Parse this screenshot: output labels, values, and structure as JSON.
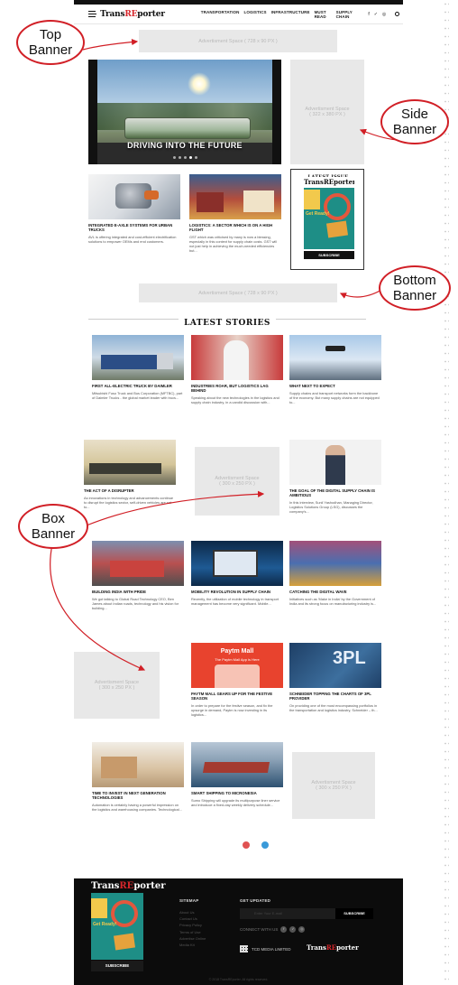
{
  "header": {
    "logo_pre": "Trans",
    "logo_re": "RE",
    "logo_post": "porter",
    "nav": [
      "TRANSPORTATION",
      "LOGISTICS",
      "INFRASTRUCTURE",
      "MUST READ",
      "SUPPLY CHAIN"
    ],
    "social": [
      "f",
      "✓",
      "◎"
    ]
  },
  "ads": {
    "top_line1": "Advertisment Space",
    "top_line2": "( 728 x 90 PX )",
    "side_line1": "Advertisment Space",
    "side_line2": "( 322 x 380 PX )",
    "bottom_line1": "Advertisment Space",
    "bottom_line2": "( 728 x 90 PX )",
    "box_line1": "Advertisment Space",
    "box_line2": "( 300 x 250 PX )"
  },
  "hero": {
    "title": "DRIVING INTO THE FUTURE",
    "slides": 5,
    "active_slide": 4
  },
  "featured": [
    {
      "title": "INTEGRATED E-AXLE SYSTEMS FOR URBAN TRUCKS",
      "excerpt": "AVL is offering integrated and cost-efficient electrification solutions to empower OEMs and end customers."
    },
    {
      "title": "LOGISTICS: A SECTOR WHICH IS ON A HIGH FLIGHT",
      "excerpt": "GST which was criticised by many is now a blessing, especially in this context for supply chain costs. GST will not just help in achieving the much-needed efficiencies but..."
    }
  ],
  "issue": {
    "heading": "LATEST ISSUE",
    "mag_title": "TransREporter",
    "mag_ready": "Get Ready!",
    "subscribe": "SUBSCRIBE"
  },
  "latest_heading": "LATEST STORIES",
  "stories": [
    {
      "title": "FIRST ALL-ELECTRIC TRUCK BY DAIMLER",
      "excerpt": "Mitsubishi Fuso Truck and Bus Corporation (MFTBC), part of Daimler Trucks - the global market leader with trucs..."
    },
    {
      "title": "INDUSTRIES ROAR, BUT LOGISTICS LAG BEHIND",
      "excerpt": "Speaking about the new technologies in the logistics and supply chain industry, in a candid discussion with..."
    },
    {
      "title": "WHAT NEXT TO EXPECT",
      "excerpt": "Supply chains and transport networks form the backbone of the economy. But many supply chains are not equipped to..."
    },
    {
      "title": "THE ACT OF A DISRUPTER",
      "excerpt": "As innovations in technology and advancements continue to disrupt the logistics sector, self-driven vehicles are set to..."
    },
    {
      "title": "THE GOAL OF THE DIGITAL SUPPLY CHAIN IS AMBITIOUS",
      "excerpt": "In this interview, Sunil Yashodhan, Managing Director, Logistics Solutions Group (LSG), discusses the company's..."
    },
    {
      "title": "BUILDING INDIA WITH PRIDE",
      "excerpt": "We got talking to Global Road Technology CEO, Ben James about Indian roads, technology and his vision for building..."
    },
    {
      "title": "MOBILITY REVOLUTION IN SUPPLY CHAIN",
      "excerpt": "Recently, the utilization of mobile technology in transport management has become very significant. Mobile..."
    },
    {
      "title": "CATCHING THE DIGITAL WAVE",
      "excerpt": "Initiatives such as 'Make in India' by the Government of India and its strong focus on manufacturing industry is..."
    },
    {
      "title": "PAYTM MALL GEARS UP FOR THE FESTIVE SEASON",
      "excerpt": "In order to prepare for the festive season, and fix the upsurge in demand, Paytm is now investing in its logistics..."
    },
    {
      "title": "SCHNEIDER TOPPING THE CHARTS OF 3PL PROVIDER",
      "excerpt": "On providing one of the most encompassing portfolios in the transportation and logistics industry, Schneider – th..."
    },
    {
      "title": "TIME TO INVEST IN NEXT GENERATION TECHNOLOGIES",
      "excerpt": "Automation is certainly having a powerful impression on the logistics and warehousing companies. Technological..."
    },
    {
      "title": "SMART SHIPPING TO MICRONESIA",
      "excerpt": "Sumo Shipping will upgrade its multipurpose liner service and introduce a fixed-day weekly delivery schedule..."
    }
  ],
  "paytm_badge": "Paytm Mall",
  "paytm_tag": "The Paytm Mall App is Here",
  "thumb_3pl": "3PL",
  "footer": {
    "logo_pre": "Trans",
    "logo_re": "RE",
    "logo_post": "porter",
    "subscribe": "SUBSCRIBE",
    "sitemap_heading": "SITEMAP",
    "sitemap_links": [
      "About Us",
      "Contact Us",
      "Privacy Policy",
      "Terms of Use",
      "Advertise Online",
      "Media Kit"
    ],
    "updated_heading": "GET UPDATED",
    "email_placeholder": "Enter Your E-mail",
    "subscribe_btn": "SUBSCRIBE",
    "connect": "CONNECT WITH US",
    "tcd": "TCD MEDIA LIMITED",
    "copyright": "© 2018 TransREporter. All rights reserved."
  },
  "callouts": {
    "top": [
      "Top",
      "Banner"
    ],
    "side": [
      "Side",
      "Banner"
    ],
    "bottom": [
      "Bottom",
      "Banner"
    ],
    "box": [
      "Box",
      "Banner"
    ]
  },
  "colors": {
    "accent_red": "#d11f26",
    "logo_red": "#d6262b",
    "page_dot_red": "#e05252",
    "page_dot_blue": "#3a9ad9",
    "footer_bg": "#0c0c0c",
    "ad_bg": "#e8e8e8"
  }
}
